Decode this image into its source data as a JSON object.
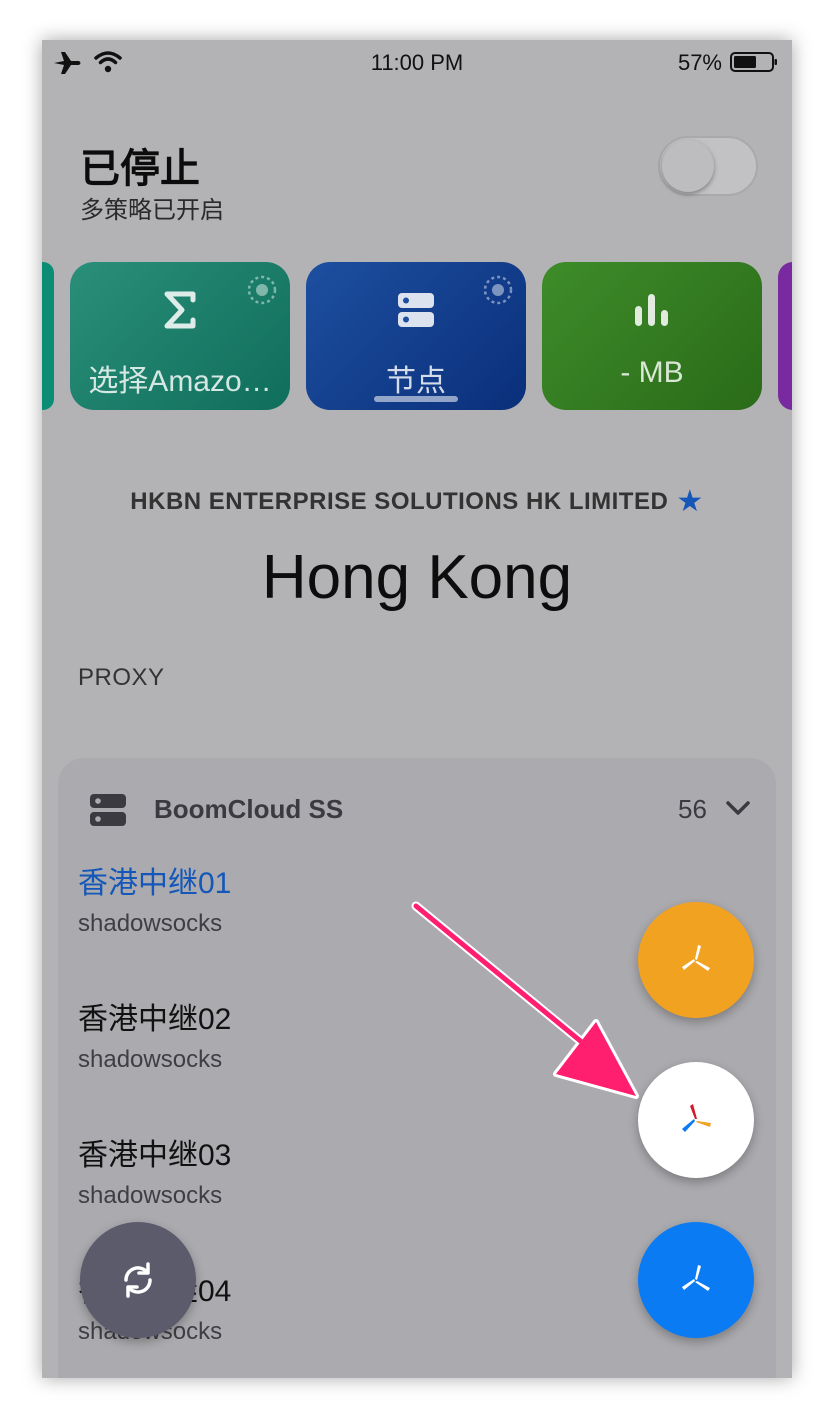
{
  "status_bar": {
    "time": "11:00 PM",
    "battery": "57%"
  },
  "header": {
    "title": "已停止",
    "subtitle": "多策略已开启"
  },
  "cards": [
    {
      "label": "选择Amazo…",
      "icon": "sigma-icon",
      "color": "#1f8a73"
    },
    {
      "label": "节点",
      "icon": "server-icon",
      "color": "#173f93"
    },
    {
      "label": "- MB",
      "icon": "bar-chart-icon",
      "color": "#357d22"
    }
  ],
  "location": {
    "isp": "HKBN ENTERPRISE SOLUTIONS HK LIMITED",
    "name": "Hong Kong",
    "section_label": "PROXY"
  },
  "group": {
    "name": "BoomCloud SS",
    "count": "56",
    "nodes": [
      {
        "name": "香港中继01",
        "type": "shadowsocks",
        "active": true
      },
      {
        "name": "香港中继02",
        "type": "shadowsocks"
      },
      {
        "name": "香港中继03",
        "type": "shadowsocks"
      },
      {
        "name": "香港中继04",
        "type": "shadowsocks"
      }
    ]
  },
  "fabs": [
    {
      "name": "orange-mode-button",
      "color": "#f2a221"
    },
    {
      "name": "white-mode-button",
      "color": "#ffffff"
    },
    {
      "name": "blue-mode-button",
      "color": "#0a7bf2"
    }
  ],
  "colors": {
    "accent": "#1457b8",
    "arrow": "#ff1f6e"
  }
}
